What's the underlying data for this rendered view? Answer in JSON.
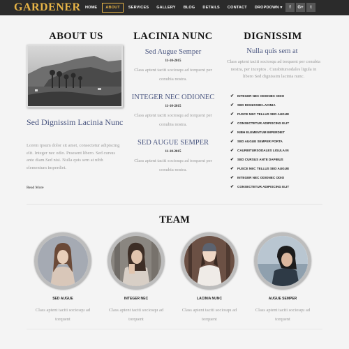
{
  "nav": {
    "brand": "GARDENER",
    "items": [
      "HOME",
      "ABOUT",
      "SERVICES",
      "GALLERY",
      "BLOG",
      "DETAILS",
      "CONTACT",
      "DROPDOWN ▾"
    ],
    "active_index": 1,
    "social": [
      "f",
      "G+",
      "t"
    ]
  },
  "about": {
    "title": "ABOUT US",
    "subtitle": "Sed Dignissim Lacinia Nunc",
    "text": "Lorem ipsum dolor sit amet, consectetur adipiscing elit. Integer nec odio. Praesent libero. Sed cursus ante diam.Sed nisi. Nulla quis sem at nibh elementum imperdiet.",
    "read_more": "Read More"
  },
  "lacinia": {
    "title": "LACINIA NUNC",
    "posts": [
      {
        "heading": "Sed Augue Semper",
        "date": "11-10-2015",
        "text": "Class aptent taciti sociosqu ad torquent per conubia nostra."
      },
      {
        "heading": "INTEGER NEC ODIONEC",
        "date": "11-10-2015",
        "text": "Class aptent taciti sociosqu ad torquent per conubia nostra."
      },
      {
        "heading": "SED AUGUE SEMPER",
        "date": "11-10-2015",
        "text": "Class aptent taciti sociosqu ad torquent per conubia nostra."
      }
    ]
  },
  "dignissim": {
    "title": "DIGNISSIM",
    "subtitle": "Nulla quis sem at",
    "text": "Class aptent taciti sociosqu ad torquent per conubia nostra, per inceptos . Curabitursodales ligula in libero Sed dignissim lacinia nunc.",
    "list": [
      "INTEGER NEC ODIONEC ODIO",
      "SED DIGNISSIM LACINIA",
      "FUSCE NEC TELLUS SED AUGUE",
      "CONSECTETUR ADIPISCING ELIT",
      "NIBH ELEMENTUM IMPERDIET",
      "SED AUGUE SEMPER PORTA",
      "CAURBITURSODALES LIGULA IN",
      "SED CURSUS ANTE DAPIBUS",
      "FUSCE NEC TELLUS SED AUGUE",
      "INTEGER NEC ODIONEC ODIO",
      "CONSECTETUR ADIPISCING ELIT"
    ]
  },
  "team": {
    "title": "TEAM",
    "members": [
      {
        "name": "SED AUGUE",
        "text": "Class aptent taciti sociosqu ad torquent"
      },
      {
        "name": "INTEGER NEC",
        "text": "Class aptent taciti sociosqu ad torquent"
      },
      {
        "name": "LACINIA NUNC",
        "text": "Class aptent taciti sociosqu ad torquent"
      },
      {
        "name": "AUGUE SEMPER",
        "text": "Class aptent taciti sociosqu ad torquent"
      }
    ]
  },
  "colors": {
    "brand": "#e8b547",
    "nav_bg": "#2b2b2b",
    "heading_blue": "#4a5680",
    "muted_text": "#999999"
  }
}
